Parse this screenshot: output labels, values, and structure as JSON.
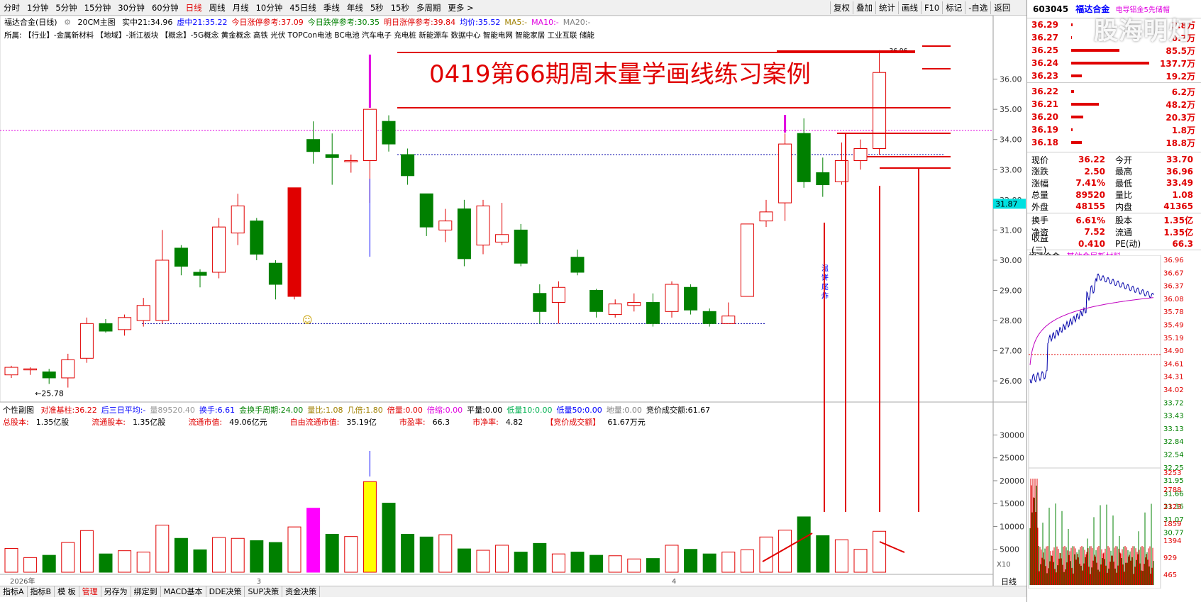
{
  "toolbar": {
    "timeframes": [
      "分时",
      "1分钟",
      "5分钟",
      "15分钟",
      "30分钟",
      "60分钟",
      "日线",
      "周线",
      "月线",
      "10分钟",
      "45日线",
      "季线",
      "年线",
      "5秒",
      "15秒",
      "多周期",
      "更多 >"
    ],
    "active_index": 6,
    "right_buttons": [
      "复权",
      "叠加",
      "统计",
      "画线",
      "F10",
      "标记",
      "-自选",
      "返回"
    ]
  },
  "main": {
    "chart_title": "福达合金(日线)",
    "main_indicator": "20CM主图",
    "info_items": [
      {
        "label": "实中21:",
        "value": "34.96",
        "color": "#000000"
      },
      {
        "label": "虚中21:",
        "value": "35.22",
        "color": "#0000ff"
      },
      {
        "label": "今日涨停参考:",
        "value": "37.09",
        "color": "#e00000"
      },
      {
        "label": "今日跌停参考:",
        "value": "30.35",
        "color": "#008000"
      },
      {
        "label": "明日涨停参考:",
        "value": "39.84",
        "color": "#e00000"
      },
      {
        "label": "均价:",
        "value": "35.52",
        "color": "#0000ff"
      },
      {
        "label": "MA5:",
        "value": "-",
        "color": "#a08000"
      },
      {
        "label": "MA10:",
        "value": "-",
        "color": "#e000e0"
      },
      {
        "label": "MA20:",
        "value": "-",
        "color": "#808080"
      }
    ],
    "tags_line": "所属:   【行业】-金属新材料 【地域】-浙江板块   【概念】-5G概念 黄金概念 高铁 光伏 TOPCon电池 BC电池 汽车电子 充电桩 新能源车 数据中心 智能电网 智能家居 工业互联 储能",
    "overlay_title": "0419第66期周末量学画线练习案例",
    "low_label": "25.78",
    "high_label": "36.96",
    "annotation": "温饼尾炸",
    "y_ticks": [
      "36.00",
      "35.00",
      "34.00",
      "33.00",
      "32.00",
      "31.00",
      "30.00",
      "29.00",
      "28.00",
      "27.00",
      "26.00"
    ],
    "price_tag": "31.87"
  },
  "sub": {
    "title": "个性副图",
    "line1": [
      {
        "label": "对准基柱:",
        "value": "36.22",
        "color": "#e00000"
      },
      {
        "label": "后三日平均:",
        "value": "-",
        "color": "#0000ff"
      },
      {
        "label": "量",
        "value": "89520.40",
        "color": "#999999"
      },
      {
        "label": "换手:",
        "value": "6.61",
        "color": "#0000ff"
      },
      {
        "label": "金换手周期:",
        "value": "24.00",
        "color": "#008000"
      },
      {
        "label": "量比:",
        "value": "1.08",
        "color": "#a08000"
      },
      {
        "label": "几倍:",
        "value": "1.80",
        "color": "#a08000"
      },
      {
        "label": "倍量:",
        "value": "0.00",
        "color": "#e00000"
      },
      {
        "label": "倍缩:",
        "value": "0.00",
        "color": "#e000e0"
      },
      {
        "label": "平量:",
        "value": "0.00",
        "color": "#000000"
      },
      {
        "label": "低量10:",
        "value": "0.00",
        "color": "#00b050"
      },
      {
        "label": "低量50:",
        "value": "0.00",
        "color": "#0000ff"
      },
      {
        "label": "地量:",
        "value": "0.00",
        "color": "#808080"
      },
      {
        "label": "竞价成交额:",
        "value": "61.67",
        "color": "#000000"
      }
    ],
    "line2": [
      {
        "label": "总股本:",
        "value": "1.35亿股"
      },
      {
        "label": "流通股本:",
        "value": "1.35亿股"
      },
      {
        "label": "流通市值:",
        "value": "49.06亿元"
      },
      {
        "label": "自由流通市值:",
        "value": "35.19亿"
      },
      {
        "label": "市盈率:",
        "value": "66.3"
      },
      {
        "label": "市净率:",
        "value": "4.82"
      },
      {
        "label": "【竞价成交额】",
        "value": "61.67万元"
      }
    ],
    "y_ticks": [
      "30000",
      "25000",
      "20000",
      "15000",
      "10000",
      "5000"
    ],
    "x_unit": "X10",
    "date_labels": [
      "2026年",
      "3",
      "4"
    ],
    "period_label": "日线"
  },
  "bottom_tabs": [
    "指标A",
    "指标B",
    "模 板",
    "管理",
    "另存为",
    "绑定到",
    "MACD基本",
    "DDE决策",
    "SUP决策",
    "资金决策"
  ],
  "bottom_active": 3,
  "right": {
    "code": "603045",
    "name": "福达合金",
    "sub_label": "电导铝金5先储帽",
    "watermark": "股海明灯",
    "sell": [
      {
        "p": "36.29",
        "v": "3.8万",
        "w": 0.02
      },
      {
        "p": "36.27",
        "v": "0.7万",
        "w": 0.01
      },
      {
        "p": "36.25",
        "v": "85.5万",
        "w": 0.62
      },
      {
        "p": "36.24",
        "v": "137.7万",
        "w": 1.0
      },
      {
        "p": "36.23",
        "v": "19.2万",
        "w": 0.14
      }
    ],
    "buy": [
      {
        "p": "36.22",
        "v": "6.2万",
        "w": 0.04
      },
      {
        "p": "36.21",
        "v": "48.2万",
        "w": 0.35
      },
      {
        "p": "36.20",
        "v": "20.3万",
        "w": 0.15
      },
      {
        "p": "36.19",
        "v": "1.8万",
        "w": 0.02
      },
      {
        "p": "36.18",
        "v": "18.8万",
        "w": 0.14
      }
    ],
    "stats": [
      [
        "现价",
        "36.22",
        "今开",
        "33.70"
      ],
      [
        "涨跌",
        "2.50",
        "最高",
        "36.96"
      ],
      [
        "涨幅",
        "7.41%",
        "最低",
        "33.49"
      ],
      [
        "总量",
        "89520",
        "量比",
        "1.08"
      ],
      [
        "外盘",
        "48155",
        "内盘",
        "41365"
      ]
    ],
    "stats2": [
      [
        "换手",
        "6.61%",
        "股本",
        "1.35亿"
      ],
      [
        "净资",
        "7.52",
        "流通",
        "1.35亿"
      ],
      [
        "收益(三)",
        "0.410",
        "PE(动)",
        "66.3"
      ]
    ],
    "mini_title": "福达合金",
    "mini_tag": "其他金属新材料",
    "mini_right_ticks": [
      "36.96",
      "36.67",
      "36.37",
      "36.08",
      "35.78",
      "35.49",
      "35.19",
      "34.90",
      "34.61",
      "34.31",
      "34.02",
      "33.72",
      "33.43",
      "33.13",
      "32.84",
      "32.54",
      "32.25",
      "31.95",
      "31.66",
      "31.36",
      "31.07",
      "30.77"
    ],
    "mini_vol_ticks": [
      "3253",
      "2788",
      "2323",
      "1859",
      "1394",
      "929",
      "465"
    ]
  },
  "candles": [
    {
      "o": 26.2,
      "c": 26.45,
      "h": 26.5,
      "l": 26.1,
      "v": 5200
    },
    {
      "o": 26.4,
      "c": 26.4,
      "h": 26.45,
      "l": 26.2,
      "v": 3200
    },
    {
      "o": 26.3,
      "c": 26.1,
      "h": 26.4,
      "l": 25.9,
      "v": 3700
    },
    {
      "o": 26.1,
      "c": 26.7,
      "h": 26.9,
      "l": 25.78,
      "v": 6500
    },
    {
      "o": 26.75,
      "c": 27.9,
      "h": 28.1,
      "l": 26.6,
      "v": 9100
    },
    {
      "o": 27.9,
      "c": 27.65,
      "h": 28.05,
      "l": 27.6,
      "v": 4000
    },
    {
      "o": 27.7,
      "c": 28.1,
      "h": 28.2,
      "l": 27.5,
      "v": 4700
    },
    {
      "o": 28.0,
      "c": 28.5,
      "h": 28.75,
      "l": 27.8,
      "v": 4400
    },
    {
      "o": 28.0,
      "c": 30.0,
      "h": 31.0,
      "l": 27.9,
      "v": 10300
    },
    {
      "o": 30.4,
      "c": 29.8,
      "h": 30.5,
      "l": 29.5,
      "v": 7400
    },
    {
      "o": 29.6,
      "c": 29.5,
      "h": 29.7,
      "l": 29.1,
      "v": 4900
    },
    {
      "o": 29.6,
      "c": 31.1,
      "h": 31.4,
      "l": 29.4,
      "v": 7600
    },
    {
      "o": 30.9,
      "c": 31.8,
      "h": 32.2,
      "l": 30.5,
      "v": 7400
    },
    {
      "o": 31.3,
      "c": 30.2,
      "h": 31.4,
      "l": 30.0,
      "v": 6900
    },
    {
      "o": 29.9,
      "c": 29.2,
      "h": 30.0,
      "l": 28.7,
      "v": 6500
    },
    {
      "o": 28.8,
      "c": 32.4,
      "h": 32.4,
      "l": 28.7,
      "v": 9900,
      "zt": true
    },
    {
      "o": 34.0,
      "c": 33.6,
      "h": 34.6,
      "l": 33.2,
      "v": 14000,
      "mag": true
    },
    {
      "o": 33.5,
      "c": 33.4,
      "h": 34.2,
      "l": 32.5,
      "v": 8300
    },
    {
      "o": 33.3,
      "c": 33.3,
      "h": 33.5,
      "l": 32.9,
      "v": 7800
    },
    {
      "o": 33.3,
      "c": 35.0,
      "h": 35.0,
      "l": 31.9,
      "v": 19800,
      "yel": true
    },
    {
      "o": 34.6,
      "c": 33.85,
      "h": 34.8,
      "l": 33.6,
      "v": 15100
    },
    {
      "o": 33.5,
      "c": 32.8,
      "h": 33.7,
      "l": 32.5,
      "v": 8300
    },
    {
      "o": 32.2,
      "c": 31.1,
      "h": 32.2,
      "l": 30.8,
      "v": 7700
    },
    {
      "o": 31.0,
      "c": 31.3,
      "h": 31.7,
      "l": 30.6,
      "v": 8200
    },
    {
      "o": 31.7,
      "c": 30.05,
      "h": 32.0,
      "l": 29.8,
      "v": 5100
    },
    {
      "o": 30.5,
      "c": 31.8,
      "h": 32.0,
      "l": 30.2,
      "v": 4800
    },
    {
      "o": 30.6,
      "c": 30.85,
      "h": 31.9,
      "l": 30.5,
      "v": 5900
    },
    {
      "o": 31.0,
      "c": 29.9,
      "h": 31.2,
      "l": 29.8,
      "v": 4400
    },
    {
      "o": 28.9,
      "c": 28.3,
      "h": 29.2,
      "l": 27.9,
      "v": 6300
    },
    {
      "o": 28.6,
      "c": 29.1,
      "h": 29.3,
      "l": 27.9,
      "v": 4000
    },
    {
      "o": 30.1,
      "c": 29.6,
      "h": 30.35,
      "l": 29.5,
      "v": 4400
    },
    {
      "o": 29.0,
      "c": 28.3,
      "h": 29.05,
      "l": 28.1,
      "v": 3700
    },
    {
      "o": 28.2,
      "c": 28.55,
      "h": 28.7,
      "l": 28.1,
      "v": 3600
    },
    {
      "o": 28.5,
      "c": 28.6,
      "h": 28.9,
      "l": 28.3,
      "v": 2900
    },
    {
      "o": 28.6,
      "c": 27.9,
      "h": 28.9,
      "l": 27.8,
      "v": 3000
    },
    {
      "o": 28.3,
      "c": 29.2,
      "h": 29.3,
      "l": 28.1,
      "v": 5900
    },
    {
      "o": 29.1,
      "c": 28.35,
      "h": 29.2,
      "l": 28.2,
      "v": 5000
    },
    {
      "o": 28.3,
      "c": 27.9,
      "h": 28.4,
      "l": 27.8,
      "v": 4000
    },
    {
      "o": 27.9,
      "c": 28.15,
      "h": 28.6,
      "l": 27.9,
      "v": 4400
    },
    {
      "o": 28.8,
      "c": 31.2,
      "h": 31.2,
      "l": 28.8,
      "v": 4900
    },
    {
      "o": 31.3,
      "c": 31.6,
      "h": 32.0,
      "l": 31.1,
      "v": 7700
    },
    {
      "o": 31.9,
      "c": 33.85,
      "h": 34.2,
      "l": 31.3,
      "v": 9200
    },
    {
      "o": 34.2,
      "c": 32.6,
      "h": 34.7,
      "l": 32.4,
      "v": 12100
    },
    {
      "o": 32.9,
      "c": 32.5,
      "h": 33.4,
      "l": 32.1,
      "v": 8000
    },
    {
      "o": 32.6,
      "c": 33.3,
      "h": 33.9,
      "l": 32.5,
      "v": 7100
    },
    {
      "o": 33.3,
      "c": 33.7,
      "h": 34.0,
      "l": 33.0,
      "v": 5000
    },
    {
      "o": 33.7,
      "c": 36.22,
      "h": 36.96,
      "l": 33.49,
      "v": 8952
    }
  ]
}
